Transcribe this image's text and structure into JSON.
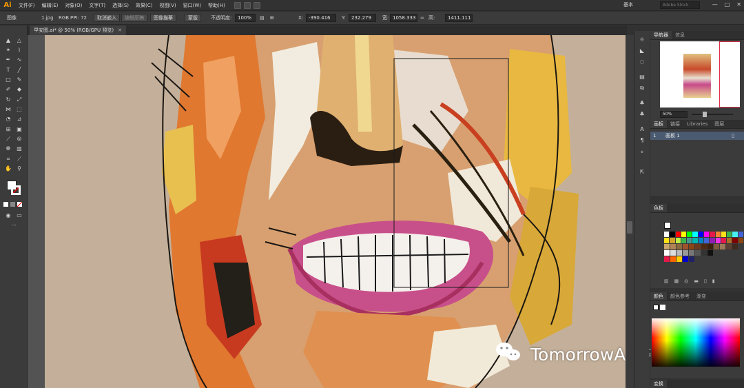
{
  "app": {
    "logo": "Ai",
    "menus": [
      "文件(F)",
      "编辑(E)",
      "对象(O)",
      "文字(T)",
      "选择(S)",
      "效果(C)",
      "视图(V)",
      "窗口(W)",
      "帮助(H)"
    ],
    "workspace": "基本",
    "search_placeholder": "Adobe Stock",
    "window_buttons": [
      "—",
      "□",
      "✕"
    ]
  },
  "control_bar": {
    "object_type": "图像",
    "file_name": "1.jpg",
    "color_info": "RGB",
    "ppi": "PPI: 72",
    "embed_button": "取消嵌入",
    "edit_original": "编辑原稿",
    "image_trace": "图像描摹",
    "mask_button": "蒙版",
    "opacity_label": "不透明度:",
    "opacity_value": "100%",
    "x_label": "X:",
    "x_value": "-390.416",
    "y_label": "Y:",
    "y_value": "232.279",
    "w_label": "宽:",
    "w_value": "1058.333",
    "h_label": "高:",
    "h_value": "1411.111"
  },
  "document": {
    "tab_title": "早安图.ai* @ 50% (RGB/GPU 预览)",
    "close": "✕"
  },
  "navigator": {
    "tabs": [
      "导航器",
      "信息"
    ],
    "zoom": "50%"
  },
  "artboards": {
    "tabs": [
      "画板",
      "链接",
      "Libraries",
      "图层"
    ],
    "rows": [
      {
        "index": "1",
        "name": "画板 1"
      }
    ]
  },
  "swatches": {
    "tabs": [
      "色板"
    ],
    "rows": [
      [
        "#ffffff",
        "#000000",
        "#ff0000",
        "#ffff00",
        "#00ff00",
        "#00ffff",
        "#0000ff",
        "#ff00ff",
        "#e6194b",
        "#f58231",
        "#ffe119",
        "#3cb44b",
        "#46f0f0",
        "#4363d8"
      ],
      [
        "#ffe119",
        "#d2a52a",
        "#bfef45",
        "#3cb44b",
        "#469990",
        "#00b5ad",
        "#0082c8",
        "#4363d8",
        "#911eb4",
        "#f032e6",
        "#e6194b",
        "#aa6e28",
        "#800000",
        "#8b4513"
      ],
      [
        "#c9a66b",
        "#b08454",
        "#8b6b3d",
        "#a0522d",
        "#8b4513",
        "#6b3a1f",
        "#4e2a12",
        "#3b1f0d",
        "#7d5a3c",
        "#9c7a5a",
        "#5c4033",
        "#3e2a1e"
      ],
      [
        "#ffffff",
        "#dddddd",
        "#bbbbbb",
        "#999999",
        "#777777",
        "#555555",
        "#333333",
        "#111111"
      ],
      [
        "#e6194b",
        "#ff6600",
        "#ffcc00",
        "#0000cc",
        "#222266"
      ]
    ]
  },
  "color": {
    "tabs": [
      "颜色",
      "颜色参考",
      "渐变"
    ]
  },
  "bottom_tab": "变换",
  "watermark": {
    "text": "TomorrowArt未来美学"
  }
}
